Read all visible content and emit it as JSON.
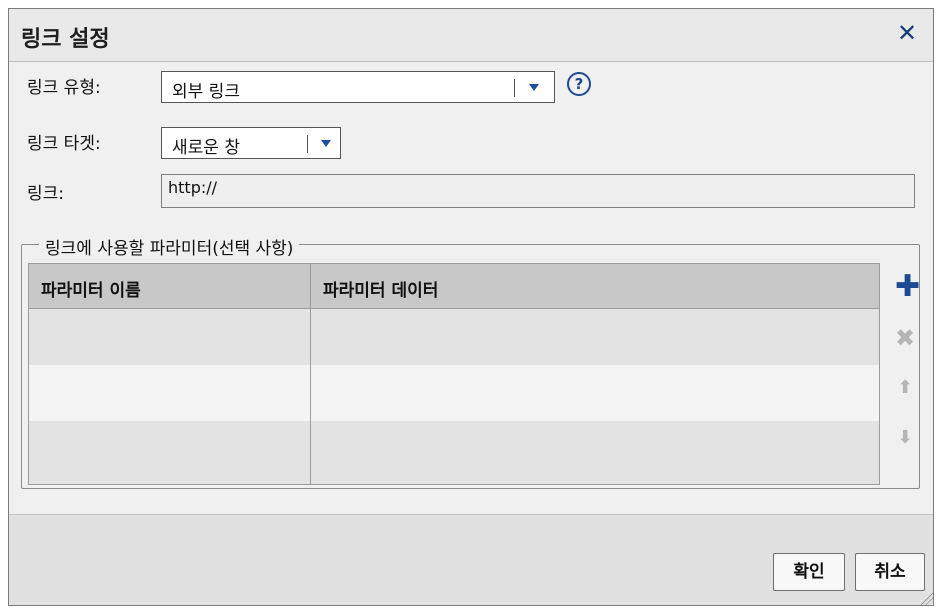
{
  "dialog": {
    "title": "링크 설정",
    "close_icon": "close-icon"
  },
  "form": {
    "link_type": {
      "label": "링크 유형:",
      "selected": "외부 링크",
      "help_icon": "?"
    },
    "link_target": {
      "label": "링크 타겟:",
      "selected": "새로운 창"
    },
    "link": {
      "label": "링크:",
      "value": "http://"
    }
  },
  "parameters": {
    "legend": "링크에 사용할 파라미터(선택 사항)",
    "columns": [
      "파라미터 이름",
      "파라미터 데이터"
    ],
    "side_icons": [
      "add-icon",
      "delete-icon",
      "move-up-icon",
      "move-down-icon"
    ]
  },
  "footer": {
    "ok_label": "확인",
    "cancel_label": "취소"
  },
  "colors": {
    "accent": "#1d4a92",
    "header_bg": "#c8c8c8",
    "disabled": "#b5b5b5"
  }
}
